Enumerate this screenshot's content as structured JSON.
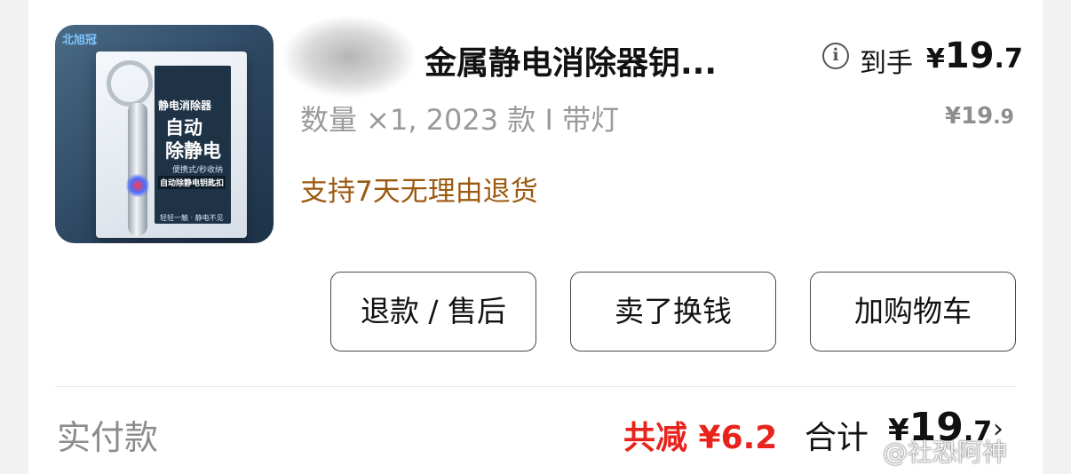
{
  "product": {
    "title": "金属静电消除器钥...",
    "spec": "数量 ×1, 2023 款 I 带灯",
    "promo": "支持7天无理由退货",
    "image_text": {
      "brand": "北旭冠",
      "line1": "静电消除器",
      "line2": "自动",
      "line3": "除静电",
      "line4": "便携式/秒收纳",
      "line5": "自动除静电钥匙扣",
      "line6": "轻轻一触 · 静电不见"
    }
  },
  "price": {
    "final_label": "到手",
    "final_currency": "¥",
    "final_int": "19",
    "final_dec": ".7",
    "original_currency": "¥",
    "original_int": "19",
    "original_dec": ".9"
  },
  "actions": {
    "refund": "退款 / 售后",
    "resell": "卖了换钱",
    "cart": "加购物车"
  },
  "summary": {
    "paid_label": "实付款",
    "discount": "共减 ¥6.2",
    "total_label": "合计",
    "total_currency": "¥",
    "total_int": "19",
    "total_dec": ".7"
  },
  "watermark": "@社恐阿神",
  "colors": {
    "promo": "#9c5a10",
    "discount": "#e8231b",
    "text": "#111111",
    "muted": "#9a9a9a"
  },
  "icons": [
    "info-icon",
    "chevron-right-icon"
  ]
}
